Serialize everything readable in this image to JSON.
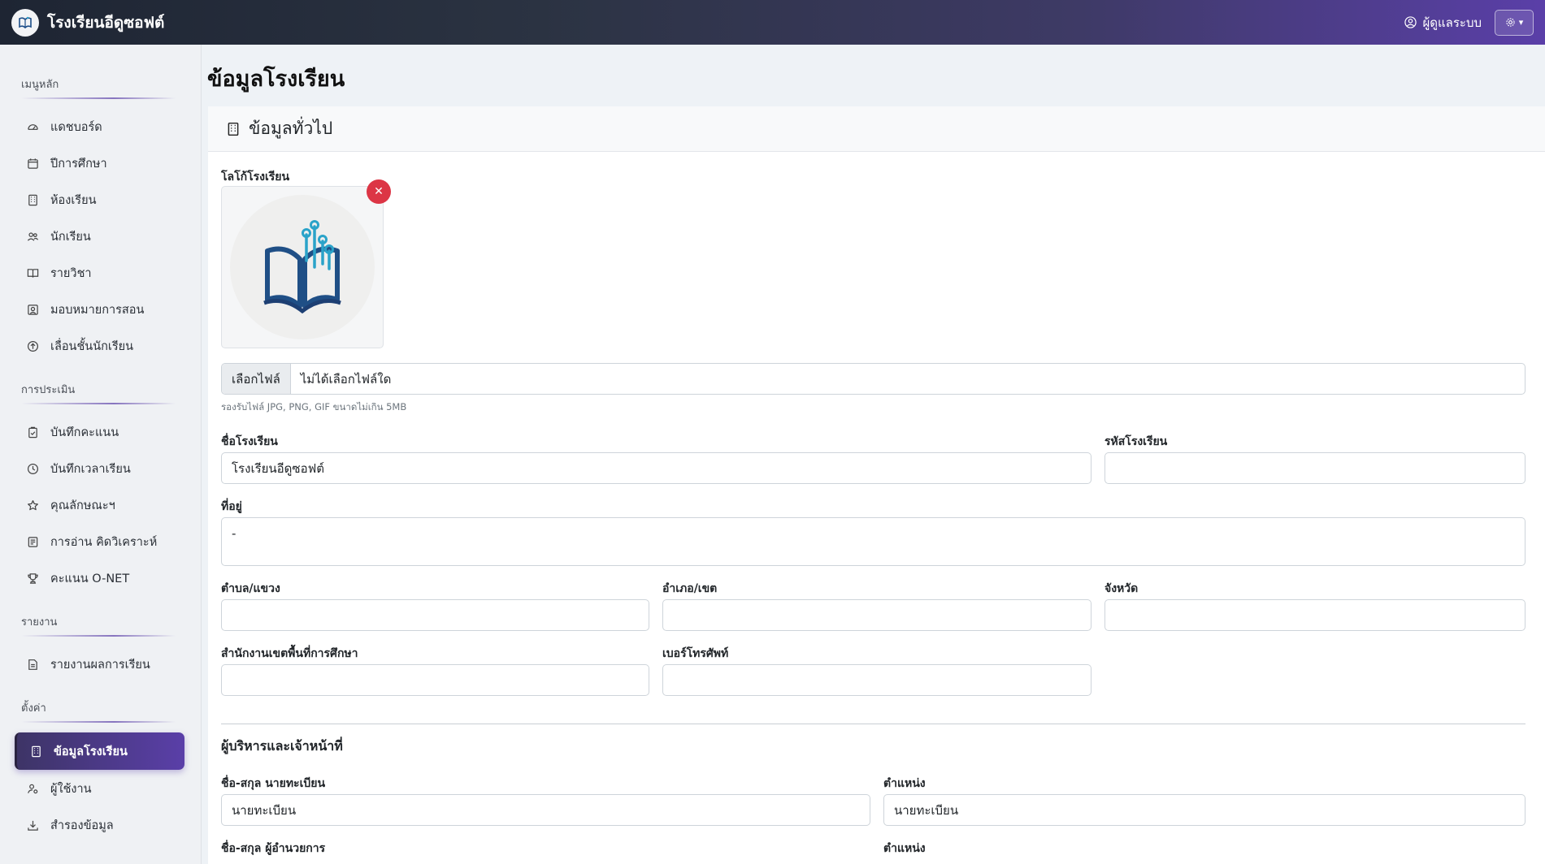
{
  "header": {
    "brand_name": "โรงเรียนอีดูซอฟต์",
    "user_label": "ผู้ดูแลระบบ"
  },
  "sidebar": {
    "sections": [
      {
        "title": "เมนูหลัก",
        "items": [
          {
            "label": "แดชบอร์ด",
            "icon": "dashboard-icon"
          },
          {
            "label": "ปีการศึกษา",
            "icon": "calendar-icon"
          },
          {
            "label": "ห้องเรียน",
            "icon": "building-icon"
          },
          {
            "label": "นักเรียน",
            "icon": "people-icon"
          },
          {
            "label": "รายวิชา",
            "icon": "book-icon"
          },
          {
            "label": "มอบหมายการสอน",
            "icon": "assign-icon"
          },
          {
            "label": "เลื่อนชั้นนักเรียน",
            "icon": "arrow-up-circle-icon"
          }
        ]
      },
      {
        "title": "การประเมิน",
        "items": [
          {
            "label": "บันทึกคะแนน",
            "icon": "clipboard-check-icon"
          },
          {
            "label": "บันทึกเวลาเรียน",
            "icon": "clock-icon"
          },
          {
            "label": "คุณลักษณะฯ",
            "icon": "star-icon"
          },
          {
            "label": "การอ่าน คิดวิเคราะห์",
            "icon": "document-icon"
          },
          {
            "label": "คะแนน O-NET",
            "icon": "trophy-icon"
          }
        ]
      },
      {
        "title": "รายงาน",
        "items": [
          {
            "label": "รายงานผลการเรียน",
            "icon": "report-icon"
          }
        ]
      },
      {
        "title": "ตั้งค่า",
        "items": [
          {
            "label": "ข้อมูลโรงเรียน",
            "icon": "building-icon",
            "active": true
          },
          {
            "label": "ผู้ใช้งาน",
            "icon": "user-gear-icon"
          },
          {
            "label": "สำรองข้อมูล",
            "icon": "download-icon"
          }
        ]
      }
    ]
  },
  "main": {
    "page_title": "ข้อมูลโรงเรียน",
    "card_title": "ข้อมูลทั่วไป",
    "logo_label": "โลโก้โรงเรียน",
    "file_button": "เลือกไฟล์",
    "file_status": "ไม่ได้เลือกไฟล์ใด",
    "file_help": "รองรับไฟล์ JPG, PNG, GIF ขนาดไม่เกิน 5MB",
    "school_name_label": "ชื่อโรงเรียน",
    "school_name_value": "โรงเรียนอีดูซอฟต์",
    "school_code_label": "รหัสโรงเรียน",
    "school_code_value": "",
    "address_label": "ที่อยู่",
    "address_value": "-",
    "subdistrict_label": "ตำบล/แขวง",
    "district_label": "อำเภอ/เขต",
    "province_label": "จังหวัด",
    "area_office_label": "สำนักงานเขตพื้นที่การศึกษา",
    "phone_label": "เบอร์โทรศัพท์",
    "staff_section_title": "ผู้บริหารและเจ้าหน้าที่",
    "registrar_name_label": "ชื่อ-สกุล นายทะเบียน",
    "registrar_name_value": "นายทะเบียน",
    "registrar_position_label": "ตำแหน่ง",
    "registrar_position_value": "นายทะเบียน",
    "director_name_label": "ชื่อ-สกุล ผู้อำนวยการ",
    "director_position_label": "ตำแหน่ง"
  }
}
